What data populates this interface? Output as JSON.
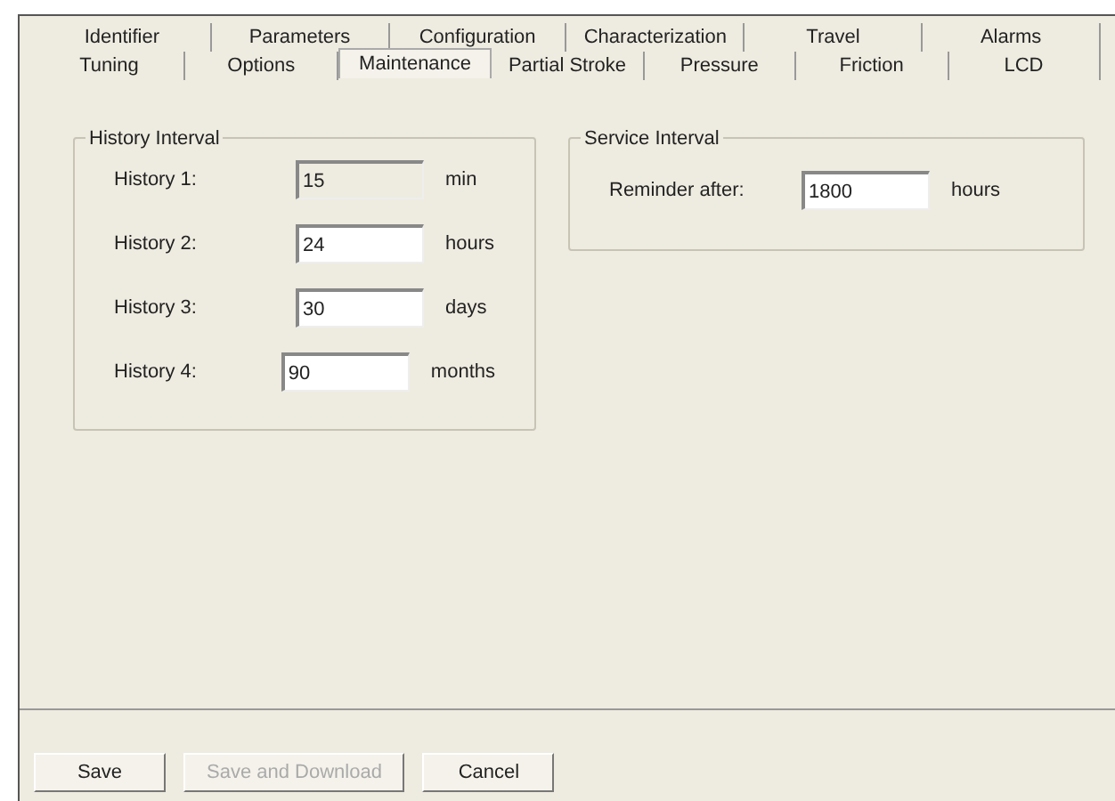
{
  "tab_rows": [
    [
      {
        "label": "Identifier",
        "selected": false
      },
      {
        "label": "Parameters",
        "selected": false
      },
      {
        "label": "Configuration",
        "selected": false
      },
      {
        "label": "Characterization",
        "selected": false
      },
      {
        "label": "Travel",
        "selected": false
      },
      {
        "label": "Alarms",
        "selected": false
      }
    ],
    [
      {
        "label": "Tuning",
        "selected": false
      },
      {
        "label": "Options",
        "selected": false
      },
      {
        "label": "Maintenance",
        "selected": true
      },
      {
        "label": "Partial Stroke",
        "selected": false
      },
      {
        "label": "Pressure",
        "selected": false
      },
      {
        "label": "Friction",
        "selected": false
      },
      {
        "label": "LCD",
        "selected": false
      }
    ]
  ],
  "history_interval": {
    "title": "History Interval",
    "rows": [
      {
        "label": "History 1:",
        "value": "15",
        "unit": "min",
        "disabled": true
      },
      {
        "label": "History 2:",
        "value": "24",
        "unit": "hours",
        "disabled": false
      },
      {
        "label": "History 3:",
        "value": "30",
        "unit": "days",
        "disabled": false
      },
      {
        "label": "History 4:",
        "value": "90",
        "unit": "months",
        "disabled": false
      }
    ]
  },
  "service_interval": {
    "title": "Service Interval",
    "label": "Reminder after:",
    "value": "1800",
    "unit": "hours"
  },
  "buttons": [
    {
      "label": "Save",
      "disabled": false
    },
    {
      "label": "Save and Download",
      "disabled": true
    },
    {
      "label": "Cancel",
      "disabled": false
    }
  ]
}
